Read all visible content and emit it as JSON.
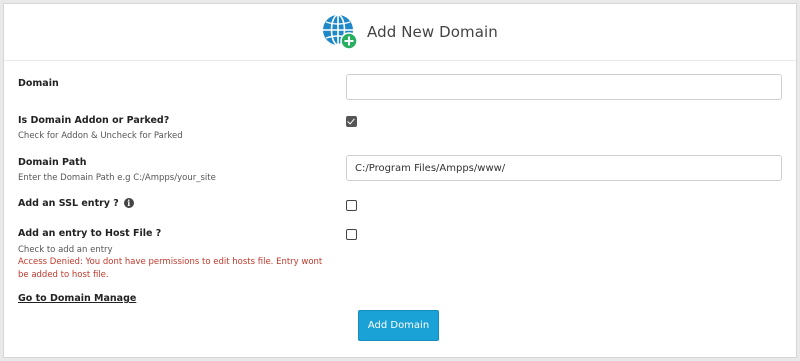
{
  "header": {
    "title": "Add New Domain",
    "icon": "globe-add-icon"
  },
  "form": {
    "domain": {
      "label": "Domain",
      "value": "",
      "placeholder": ""
    },
    "addon": {
      "label": "Is Domain Addon or Parked?",
      "help": "Check for Addon & Uncheck for Parked",
      "checked": true
    },
    "path": {
      "label": "Domain Path",
      "help": "Enter the Domain Path e.g C:/Ampps/your_site",
      "value": "C:/Program Files/Ampps/www/"
    },
    "ssl": {
      "label": "Add an SSL entry ?",
      "info_glyph": "i",
      "checked": false
    },
    "hostfile": {
      "label": "Add an entry to Host File ?",
      "help": "Check to add an entry",
      "error": "Access Denied: You dont have permissions to edit hosts file. Entry wont be added to host file.",
      "checked": false
    }
  },
  "link": {
    "label": "Go to Domain Manage"
  },
  "submit": {
    "label": "Add Domain"
  },
  "colors": {
    "accent": "#1aa1d6",
    "error": "#c0392b",
    "globe": "#1e88c8",
    "plus_badge": "#27ae60"
  }
}
